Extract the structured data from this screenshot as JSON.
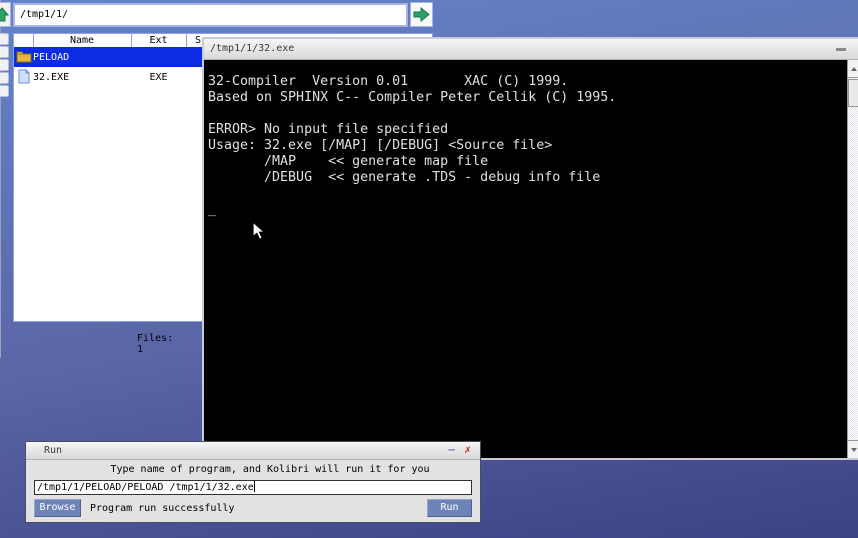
{
  "colors": {
    "desktop_top": "#6484c8",
    "desktop_bottom": "#3c4184",
    "selection_blue": "#0c2ce4",
    "accent_green": "#1fa05a",
    "button_blue": "#6e83b7",
    "close_red": "#cc2222",
    "console_bg": "#000000",
    "console_text": "#e0e0e0"
  },
  "file_manager": {
    "address_value": "/tmp1/1/",
    "columns": [
      "Name",
      "Ext",
      "S"
    ],
    "rows": [
      {
        "name": "PELOAD",
        "ext": "",
        "icon": "folder-icon",
        "selected": true
      },
      {
        "name": "32.EXE",
        "ext": "EXE",
        "icon": "file-icon",
        "selected": false
      }
    ],
    "status": "Files: 1"
  },
  "console": {
    "title": "/tmp1/1/32.exe",
    "lines": [
      "32-Compiler  Version 0.01       XAC (C) 1999.",
      "Based on SPHINX C-- Compiler Peter Cellik (C) 1995.",
      "",
      "ERROR> No input file specified",
      "Usage: 32.exe [/MAP] [/DEBUG] <Source file>",
      "       /MAP    << generate map file",
      "       /DEBUG  << generate .TDS - debug info file",
      "",
      "_"
    ]
  },
  "run_dialog": {
    "title": "Run",
    "minimize_label": "–",
    "close_label": "✗",
    "instruction": "Type name of program, and Kolibri will run it for you",
    "input_value": "/tmp1/1/PELOAD/PELOAD /tmp1/1/32.exe",
    "browse_label": "Browse",
    "status": "Program run successfully",
    "run_label": "Run"
  }
}
